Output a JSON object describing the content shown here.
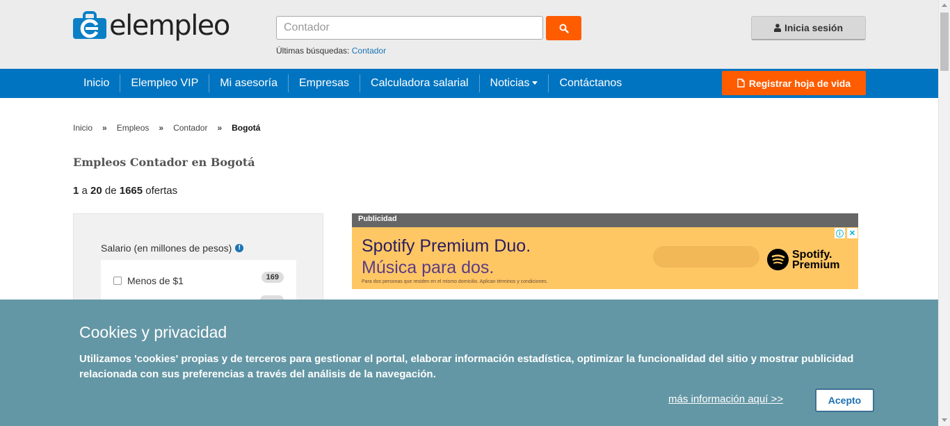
{
  "header": {
    "logo_text": "elempleo",
    "search": {
      "value": "Contador",
      "placeholder": "Contador"
    },
    "recent_label": "Últimas búsquedas:",
    "recent_link": "Contador",
    "login_label": "Inicia sesión"
  },
  "nav": {
    "items": [
      {
        "label": "Inicio"
      },
      {
        "label": "Elempleo VIP"
      },
      {
        "label": "Mi asesoría"
      },
      {
        "label": "Empresas"
      },
      {
        "label": "Calculadora salarial"
      },
      {
        "label": "Noticias"
      },
      {
        "label": "Contáctanos"
      }
    ],
    "register_label": "Registrar hoja de vida"
  },
  "breadcrumb": {
    "items": [
      "Inicio",
      "Empleos",
      "Contador",
      "Bogotá"
    ],
    "separator": "»"
  },
  "page": {
    "title": "Empleos Contador en Bogotá",
    "results": {
      "from": "1",
      "a": "a",
      "to": "20",
      "de": "de",
      "total": "1665",
      "suffix": "ofertas"
    }
  },
  "sidebar": {
    "filter_title": "Salario (en millones de pesos)",
    "options": [
      {
        "label": "Menos de $1",
        "count": "169"
      }
    ]
  },
  "ad": {
    "header": "Publicidad",
    "line1": "Spotify Premium Duo.",
    "line2": "Música para dos.",
    "fine_print": "Para dos personas que residen en el mismo domicilio. Aplican términos y condiciones.",
    "brand_line1": "Spotify.",
    "brand_line2": "Premium",
    "info_glyph": "ⓘ",
    "close_glyph": "✕"
  },
  "cookie": {
    "title": "Cookies y privacidad",
    "text": "Utilizamos 'cookies' propias y de terceros para gestionar el portal, elaborar información estadística, optimizar la funcionalidad del sitio y mostrar publicidad relacionada con sus preferencias a través del análisis de la navegación.",
    "link": "más información aquí >>",
    "accept": "Acepto"
  },
  "colors": {
    "brand_blue": "#0074c1",
    "brand_orange": "#ff5c00",
    "cookie_bg": "#6497a5"
  }
}
